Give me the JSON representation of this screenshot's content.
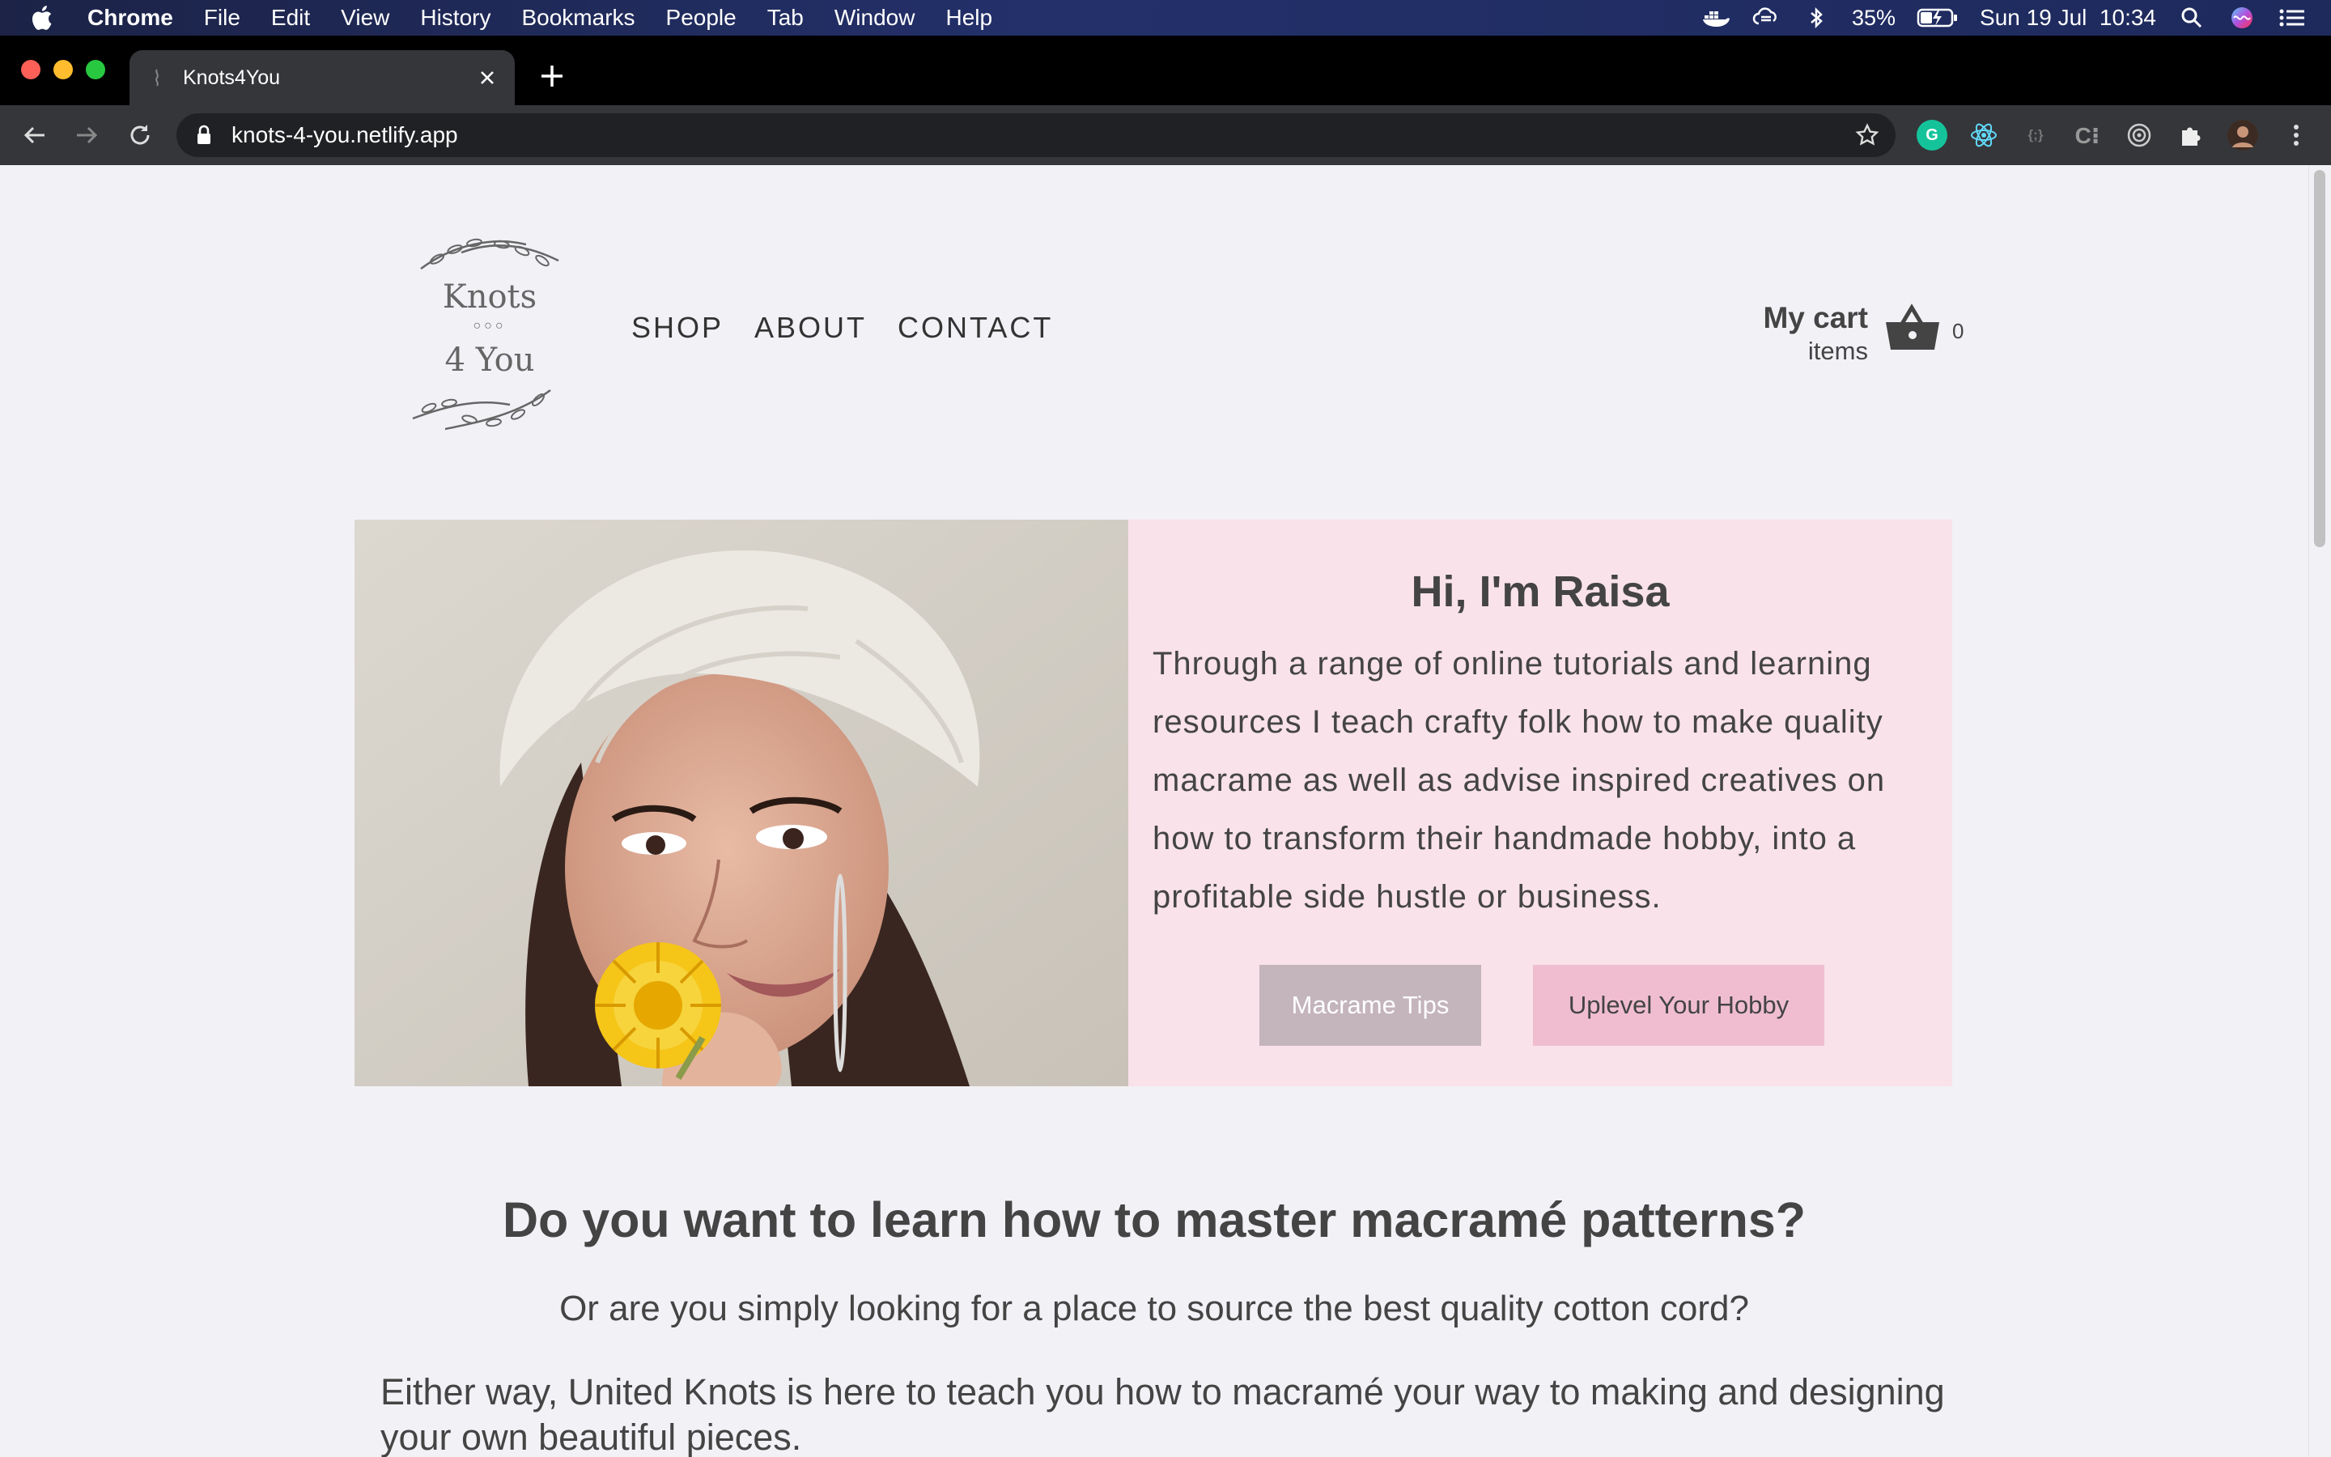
{
  "menubar": {
    "app": "Chrome",
    "menus": [
      "File",
      "Edit",
      "View",
      "History",
      "Bookmarks",
      "People",
      "Tab",
      "Window",
      "Help"
    ],
    "battery": "35%",
    "datetime": "Sun 19 Jul  10:34"
  },
  "browser": {
    "tab_title": "Knots4You",
    "url": "knots-4-you.netlify.app"
  },
  "site": {
    "logo_text_1": "Knots",
    "logo_dots": "○○○",
    "logo_text_2": "4 You",
    "nav": [
      "SHOP",
      "ABOUT",
      "CONTACT"
    ],
    "cart": {
      "title": "My cart",
      "items_label": "items",
      "count": "0"
    },
    "hero": {
      "heading": "Hi, I'm Raisa",
      "body": "Through a range of online tutorials and learning resources I teach crafty folk how to make quality macrame as well as advise inspired creatives on how to transform their handmade hobby, into a profitable side hustle or business.",
      "button_tips": "Macrame Tips",
      "button_hobby": "Uplevel Your Hobby"
    },
    "section_heading": "Do you want to learn how to master macramé patterns?",
    "section_sub": "Or are you simply looking for a place to source the best quality cotton cord?",
    "section_para": "Either way, United Knots is here to teach you how to macramé your way to making and designing your own beautiful pieces."
  },
  "colors": {
    "page_bg": "#f2f1f6",
    "hero_bg": "#f9e2e9",
    "button_tips": "#c4b4bc",
    "button_hobby": "#f0bdd0",
    "text": "#444444"
  }
}
